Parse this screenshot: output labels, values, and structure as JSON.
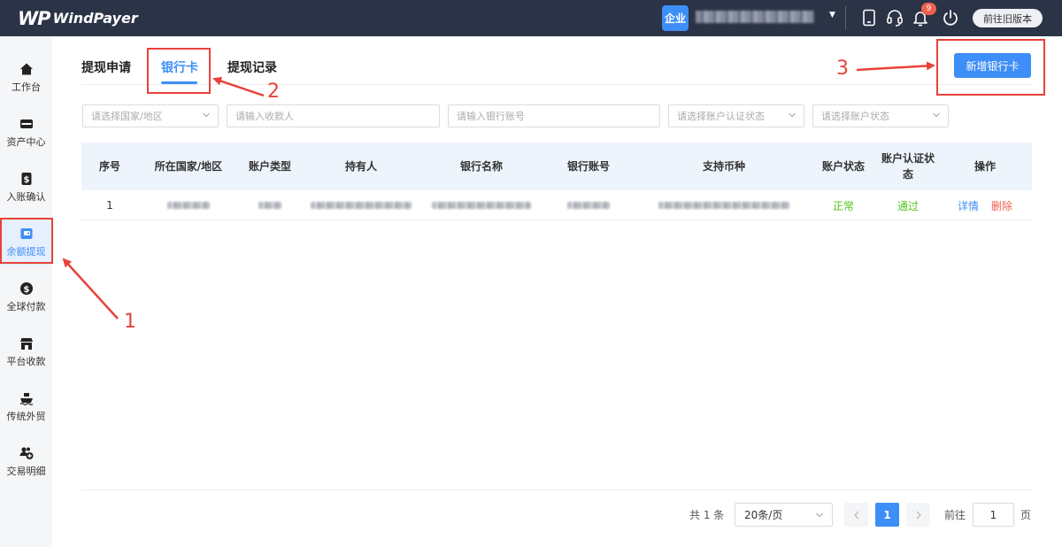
{
  "brand": {
    "mark": "WP",
    "name": "WindPayer"
  },
  "header": {
    "account_type_badge": "企业",
    "notification_count": "9",
    "old_version_label": "前往旧版本",
    "icons": [
      "tablet-icon",
      "headset-icon",
      "bell-icon",
      "power-icon"
    ]
  },
  "sidebar": {
    "items": [
      {
        "label": "工作台",
        "icon": "home-icon"
      },
      {
        "label": "资产中心",
        "icon": "wallet-card-icon"
      },
      {
        "label": "入账确认",
        "icon": "dollar-doc-icon"
      },
      {
        "label": "余额提现",
        "icon": "withdraw-wallet-icon",
        "active": true
      },
      {
        "label": "全球付款",
        "icon": "dollar-circle-icon"
      },
      {
        "label": "平台收款",
        "icon": "store-icon"
      },
      {
        "label": "传统外贸",
        "icon": "ship-icon"
      },
      {
        "label": "交易明细",
        "icon": "users-plus-icon"
      }
    ]
  },
  "tabs": [
    {
      "label": "提现申请"
    },
    {
      "label": "银行卡",
      "active": true
    },
    {
      "label": "提现记录"
    }
  ],
  "toolbar": {
    "add_bank_card_label": "新增银行卡"
  },
  "filters": {
    "country_placeholder": "请选择国家/地区",
    "payee_placeholder": "请输入收款人",
    "account_no_placeholder": "请输入银行账号",
    "verify_status_placeholder": "请选择账户认证状态",
    "account_status_placeholder": "请选择账户状态"
  },
  "table": {
    "headers": {
      "index": "序号",
      "country": "所在国家/地区",
      "account_type": "账户类型",
      "holder": "持有人",
      "bank_name": "银行名称",
      "account_no": "银行账号",
      "currencies": "支持币种",
      "account_status": "账户状态",
      "verify_status": "账户认证状态",
      "actions": "操作"
    },
    "rows": [
      {
        "index": "1",
        "account_status": "正常",
        "verify_status": "通过",
        "detail_label": "详情",
        "delete_label": "删除"
      }
    ]
  },
  "pagination": {
    "total_text": "共 1 条",
    "page_size": "20条/页",
    "current_page": "1",
    "goto_label": "前往",
    "goto_value": "1",
    "page_suffix": "页"
  },
  "annotations": {
    "step1": "1",
    "step2": "2",
    "step3": "3"
  },
  "colors": {
    "accent": "#3e8ef7",
    "topbar": "#2b3346",
    "success": "#52c41a",
    "danger": "#f0604d",
    "annotation": "#e8423a"
  }
}
